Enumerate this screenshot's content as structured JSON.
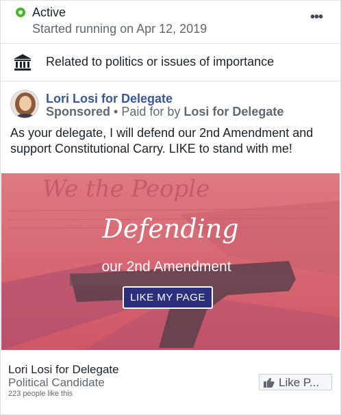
{
  "status": {
    "active_label": "Active",
    "started_text": "Started running on Apr 12, 2019",
    "more_label": "•••",
    "status_color": "#42b72a"
  },
  "politics": {
    "icon": "bank-icon",
    "label": "Related to politics or issues of importance"
  },
  "ad": {
    "page_name": "Lori Losi for Delegate",
    "sponsored_label": "Sponsored",
    "paid_for_prefix": " • Paid for by ",
    "paid_for_name": "Losi for Delegate",
    "body_text": "As your delegate, I will defend our 2nd Amendment and support Constitutional Carry. LIKE to stand with me!",
    "link_color": "#365899"
  },
  "creative": {
    "title": "Defending",
    "subtitle": "our 2nd Amendment",
    "cta_label": "LIKE MY PAGE",
    "tint_color": "#d9646f",
    "cta_color": "#2b2f7e"
  },
  "footer": {
    "page_name": "Lori Losi for Delegate",
    "category": "Political Candidate",
    "likes_text": "223 people like this",
    "like_button_label": "Like P...",
    "like_icon": "thumbs-up-icon"
  }
}
